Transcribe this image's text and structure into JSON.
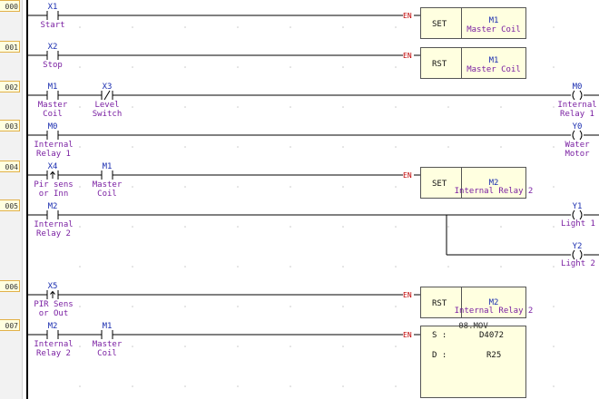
{
  "rung_numbers": [
    "000",
    "001",
    "002",
    "003",
    "004",
    "005",
    "006",
    "007"
  ],
  "en_label": "EN",
  "rungs": {
    "r0": {
      "contact": {
        "address": "X1",
        "comment": "Start"
      },
      "instr": {
        "op": "SET",
        "address": "M1",
        "comment": "Master Coil"
      }
    },
    "r1": {
      "contact": {
        "address": "X2",
        "comment": "Stop"
      },
      "instr": {
        "op": "RST",
        "address": "M1",
        "comment": "Master Coil"
      }
    },
    "r2": {
      "contact1": {
        "address": "M1",
        "comment1": "Master",
        "comment2": "Coil"
      },
      "contact2": {
        "address": "X3",
        "comment1": "Level",
        "comment2": "Switch"
      },
      "coil": {
        "address": "M0",
        "comment1": "Internal",
        "comment2": "Relay 1"
      }
    },
    "r3": {
      "contact": {
        "address": "M0",
        "comment1": "Internal",
        "comment2": "Relay 1"
      },
      "coil": {
        "address": "Y0",
        "comment1": "Water",
        "comment2": "Motor"
      }
    },
    "r4": {
      "contact1": {
        "address": "X4",
        "comment1": "Pir sens",
        "comment2": "or Inn"
      },
      "contact2": {
        "address": "M1",
        "comment1": "Master",
        "comment2": "Coil"
      },
      "instr": {
        "op": "SET",
        "address": "M2",
        "comment": "Internal Relay 2"
      }
    },
    "r5": {
      "contact": {
        "address": "M2",
        "comment1": "Internal",
        "comment2": "Relay 2"
      },
      "coil1": {
        "address": "Y1",
        "comment": "Light 1"
      },
      "coil2": {
        "address": "Y2",
        "comment": "Light 2"
      }
    },
    "r6": {
      "contact": {
        "address": "X5",
        "comment1": "PIR Sens",
        "comment2": "or Out"
      },
      "instr": {
        "op": "RST",
        "address": "M2",
        "comment": "Internal Relay 2"
      }
    },
    "r7": {
      "contact1": {
        "address": "M2",
        "comment1": "Internal",
        "comment2": "Relay 2"
      },
      "contact2": {
        "address": "M1",
        "comment1": "Master",
        "comment2": "Coil"
      },
      "func": {
        "title": "08.MOV",
        "s_label": "S :",
        "s_value": "D4072",
        "d_label": "D :",
        "d_value": "R25"
      }
    }
  }
}
